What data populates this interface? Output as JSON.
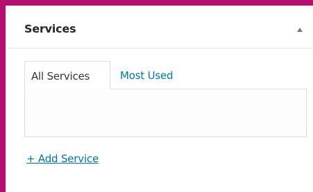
{
  "panel": {
    "title": "Services",
    "toggle_icon": "triangle-up-icon"
  },
  "tabs": [
    {
      "label": "All Services",
      "active": true
    },
    {
      "label": "Most Used",
      "active": false
    }
  ],
  "add_link": "+ Add Service",
  "colors": {
    "frame": "#b40f6e",
    "link": "#0073aa",
    "text": "#23282d"
  }
}
